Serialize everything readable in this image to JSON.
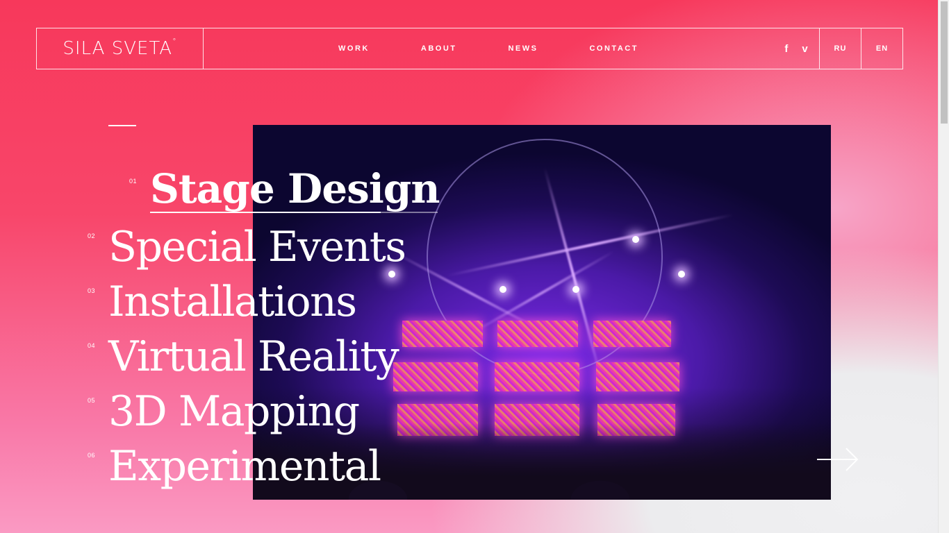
{
  "header": {
    "logo": "SILA SVETA",
    "logo_mark": "°",
    "nav": [
      {
        "label": "WORK"
      },
      {
        "label": "ABOUT"
      },
      {
        "label": "NEWS"
      },
      {
        "label": "CONTACT"
      }
    ],
    "social": {
      "facebook": "f",
      "vimeo": "v"
    },
    "languages": [
      "RU",
      "EN"
    ]
  },
  "categories": [
    {
      "number": "01",
      "title": "Stage Design",
      "active": true
    },
    {
      "number": "02",
      "title": "Special Events"
    },
    {
      "number": "03",
      "title": "Installations"
    },
    {
      "number": "04",
      "title": "Virtual Reality"
    },
    {
      "number": "05",
      "title": "3D Mapping"
    },
    {
      "number": "06",
      "title": "Experimental"
    }
  ],
  "icons": {
    "next": "arrow-right-icon",
    "facebook": "facebook-icon",
    "vimeo": "vimeo-icon"
  },
  "colors": {
    "primary": "#f7385b",
    "gradient_end": "#fa9ac3",
    "light": "#ececee",
    "text": "#ffffff"
  }
}
